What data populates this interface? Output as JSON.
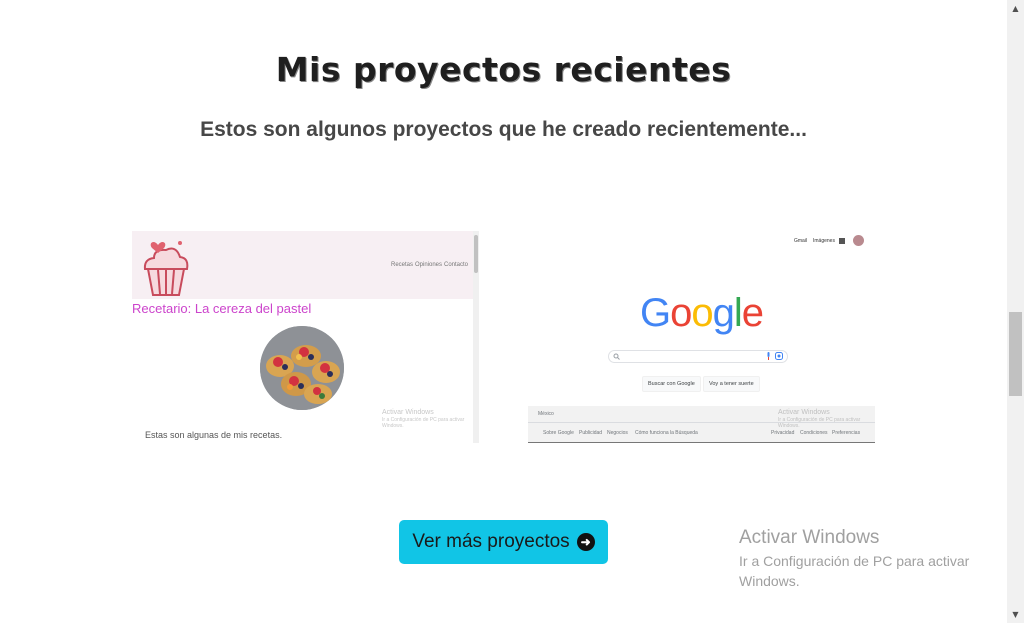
{
  "section": {
    "title": "Mis proyectos recientes",
    "subtitle": "Estos son algunos proyectos que he creado recientemente..."
  },
  "project1": {
    "nav": [
      "Recetas",
      "Opiniones",
      "Contacto"
    ],
    "heading": "Recetario: La cereza del pastel",
    "watermark_title": "Activar Windows",
    "watermark_body": "Ir a Configuración de PC para activar Windows.",
    "text": "Estas son algunas de mis recetas."
  },
  "project2": {
    "top_links": [
      "Gmail",
      "Imágenes"
    ],
    "logo": [
      "G",
      "o",
      "o",
      "g",
      "l",
      "e"
    ],
    "logo_colors": [
      "#4285f4",
      "#ea4335",
      "#fbbc05",
      "#4285f4",
      "#34a853",
      "#ea4335"
    ],
    "buttons": [
      "Buscar con Google",
      "Voy a tener suerte"
    ],
    "country": "México",
    "footer_left": [
      "Sobre Google",
      "Publicidad",
      "Negocios",
      "Cómo funciona la Búsqueda"
    ],
    "footer_right": [
      "Privacidad",
      "Condiciones",
      "Preferencias"
    ],
    "watermark_title": "Activar Windows",
    "watermark_body": "Ir a Configuración de PC para activar Windows."
  },
  "cta": {
    "label": "Ver más proyectos",
    "icon": "arrow-right-circle-icon",
    "color": "#11c5e6"
  },
  "windows_watermark": {
    "title": "Activar Windows",
    "body": "Ir a Configuración de PC para activar Windows."
  }
}
